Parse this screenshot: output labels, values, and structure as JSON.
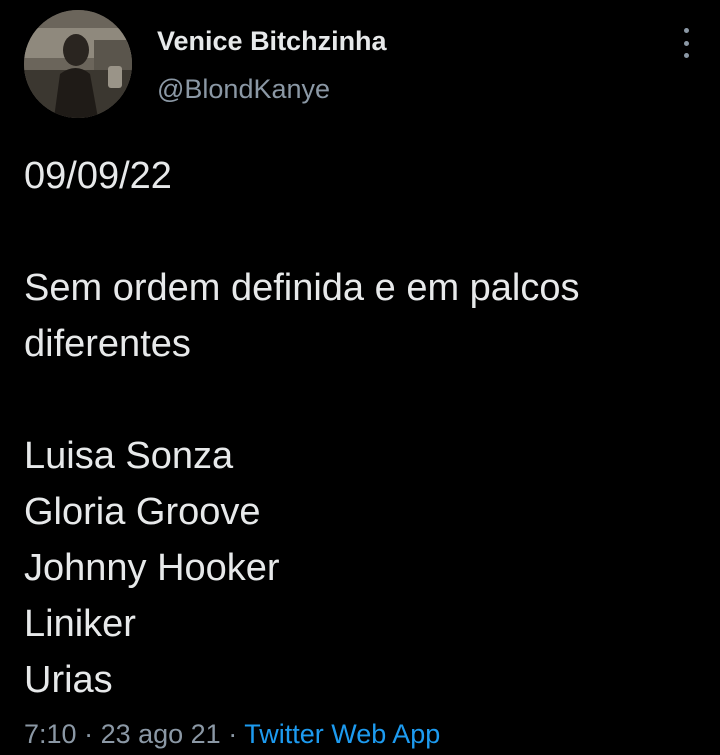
{
  "user": {
    "display_name": "Venice Bitchzinha",
    "handle": "@BlondKanye",
    "avatar_icon": "profile-photo"
  },
  "more_icon": "vertical-ellipsis-icon",
  "tweet": {
    "date_line": "09/09/22",
    "intro_line_1": "Sem ordem definida e em palcos",
    "intro_line_2": "diferentes",
    "artists": [
      "Luisa Sonza",
      "Gloria Groove",
      "Johnny Hooker",
      "Liniker",
      "Urias"
    ]
  },
  "meta": {
    "time": "7:10",
    "separator": " · ",
    "date": "23 ago 21",
    "source": "Twitter Web App"
  },
  "colors": {
    "background": "#000000",
    "text_primary": "#e7e9ea",
    "text_secondary": "#8b98a5",
    "link": "#1d9bf0"
  }
}
